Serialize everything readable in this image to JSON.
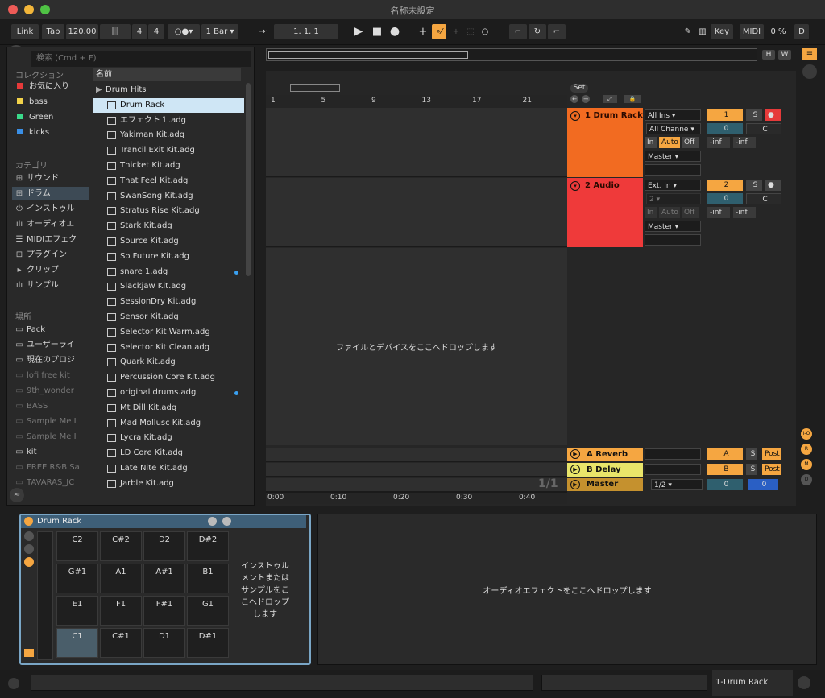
{
  "window": {
    "title": "名称未設定"
  },
  "transport": {
    "link": "Link",
    "tap": "Tap",
    "tempo": "120.00",
    "time_sig_num": "4",
    "time_sig_den": "4",
    "quant": "1 Bar",
    "position": "1.   1.   1",
    "key": "Key",
    "midi": "MIDI",
    "cpu": "0 %",
    "d": "D"
  },
  "arrangement": {
    "h": "H",
    "w": "W"
  },
  "browser": {
    "search_placeholder": "検索 (Cmd + F)",
    "collections_head": "コレクション",
    "collections": [
      {
        "label": "お気に入り",
        "color": "#e63a3a"
      },
      {
        "label": "bass",
        "color": "#f2d24a"
      },
      {
        "label": "Green",
        "color": "#3ad98a"
      },
      {
        "label": "kicks",
        "color": "#3a8fe6"
      }
    ],
    "category_head": "カテゴリ",
    "categories": [
      "サウンド",
      "ドラム",
      "インストゥル",
      "オーディオエ",
      "MIDIエフェク",
      "プラグイン",
      "クリップ",
      "サンプル"
    ],
    "places_head": "場所",
    "places": [
      "Pack",
      "ユーザーライ",
      "現在のプロジ",
      "lofi free kit",
      "9th_wonder",
      "BASS",
      "Sample Me I",
      "Sample Me I",
      "kit",
      "FREE R&B Sa",
      "TAVARAS_JC"
    ],
    "column_head": "名前",
    "files": [
      "Drum Hits",
      "Drum Rack",
      "エフェクト１.adg",
      "Yakiman Kit.adg",
      "Trancil Exit Kit.adg",
      "Thicket Kit.adg",
      "That Feel Kit.adg",
      "SwanSong Kit.adg",
      "Stratus Rise Kit.adg",
      "Stark Kit.adg",
      "Source Kit.adg",
      "So Future Kit.adg",
      "snare 1.adg",
      "Slackjaw Kit.adg",
      "SessionDry Kit.adg",
      "Sensor Kit.adg",
      "Selector Kit Warm.adg",
      "Selector Kit Clean.adg",
      "Quark Kit.adg",
      "Percussion Core Kit.adg",
      "original drums.adg",
      "Mt Dill Kit.adg",
      "Mad Mollusc Kit.adg",
      "Lycra Kit.adg",
      "LD Core Kit.adg",
      "Late Nite Kit.adg",
      "Jarble Kit.adg"
    ]
  },
  "ruler": {
    "bars": [
      "1",
      "5",
      "9",
      "13",
      "17",
      "21"
    ],
    "times": [
      "0:00",
      "0:10",
      "0:20",
      "0:30",
      "0:40"
    ]
  },
  "set_label": "Set",
  "tracks": [
    {
      "name": "1 Drum Rack",
      "color": "#f26b21",
      "input": "All Ins",
      "channel": "All Channe",
      "in": "In",
      "auto": "Auto",
      "off": "Off",
      "output": "Master",
      "num": "1",
      "solo": "S",
      "vol": "0",
      "pan": "C",
      "inf1": "-inf",
      "inf2": "-inf"
    },
    {
      "name": "2 Audio",
      "color": "#ef3a3a",
      "input": "Ext. In",
      "channel": "2",
      "in": "In",
      "auto": "Auto",
      "off": "Off",
      "output": "Master",
      "num": "2",
      "solo": "S",
      "vol": "0",
      "pan": "C",
      "inf1": "-inf",
      "inf2": "-inf"
    }
  ],
  "drop_hint": "ファイルとデバイスをここへドロップします",
  "returns": [
    {
      "name": "A Reverb",
      "color": "#f5a641",
      "letter": "A",
      "solo": "S",
      "post": "Post"
    },
    {
      "name": "B Delay",
      "color": "#e9e56a",
      "letter": "B",
      "solo": "S",
      "post": "Post"
    }
  ],
  "master": {
    "name": "Master",
    "sel": "1/2",
    "vol": "0",
    "vol2": "0",
    "page": "1/1"
  },
  "right_letters": [
    "I-O",
    "R",
    "M",
    "D"
  ],
  "device": {
    "title": "Drum Rack",
    "pads": [
      "C2",
      "C#2",
      "D2",
      "D#2",
      "G#1",
      "A1",
      "A#1",
      "B1",
      "E1",
      "F1",
      "F#1",
      "G1",
      "C1",
      "C#1",
      "D1",
      "D#1"
    ],
    "drop_text": "インストゥルメントまたはサンプルをここへドロップします"
  },
  "fx_drop": "オーディオエフェクトをここへドロップします",
  "status": {
    "track": "1-Drum Rack"
  }
}
